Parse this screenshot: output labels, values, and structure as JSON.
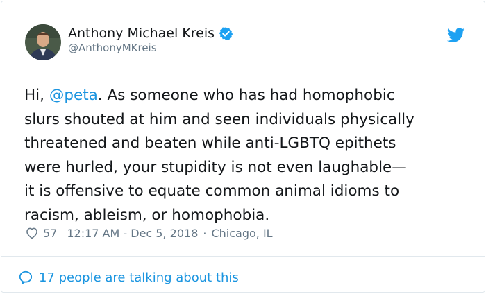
{
  "author": {
    "name": "Anthony Michael Kreis",
    "handle": "@AnthonyMKreis"
  },
  "tweet": {
    "greeting": "Hi, ",
    "mention": "@peta",
    "body": ". As someone who has had homophobic\nslurs shouted at him and seen individuals physically\nthreatened and beaten while anti-LGBTQ epithets\nwere hurled, your stupidity is not even laughable—\nit is offensive to equate common animal idioms to\nracism, ableism, or homophobia."
  },
  "meta": {
    "likes": "57",
    "timestamp": "12:17 AM - Dec 5, 2018",
    "separator": "·",
    "location": "Chicago, IL"
  },
  "footer": {
    "talking_text": "17 people are talking about this"
  },
  "colors": {
    "accent": "#1b95e0",
    "twitter_blue": "#1da1f2",
    "text_primary": "#14171a",
    "text_secondary": "#657786",
    "border": "#e1e8ed"
  },
  "icons": {
    "verified": "verified-badge-icon",
    "brand": "twitter-bird-icon",
    "like": "heart-icon",
    "conversation": "speech-bubble-icon"
  }
}
